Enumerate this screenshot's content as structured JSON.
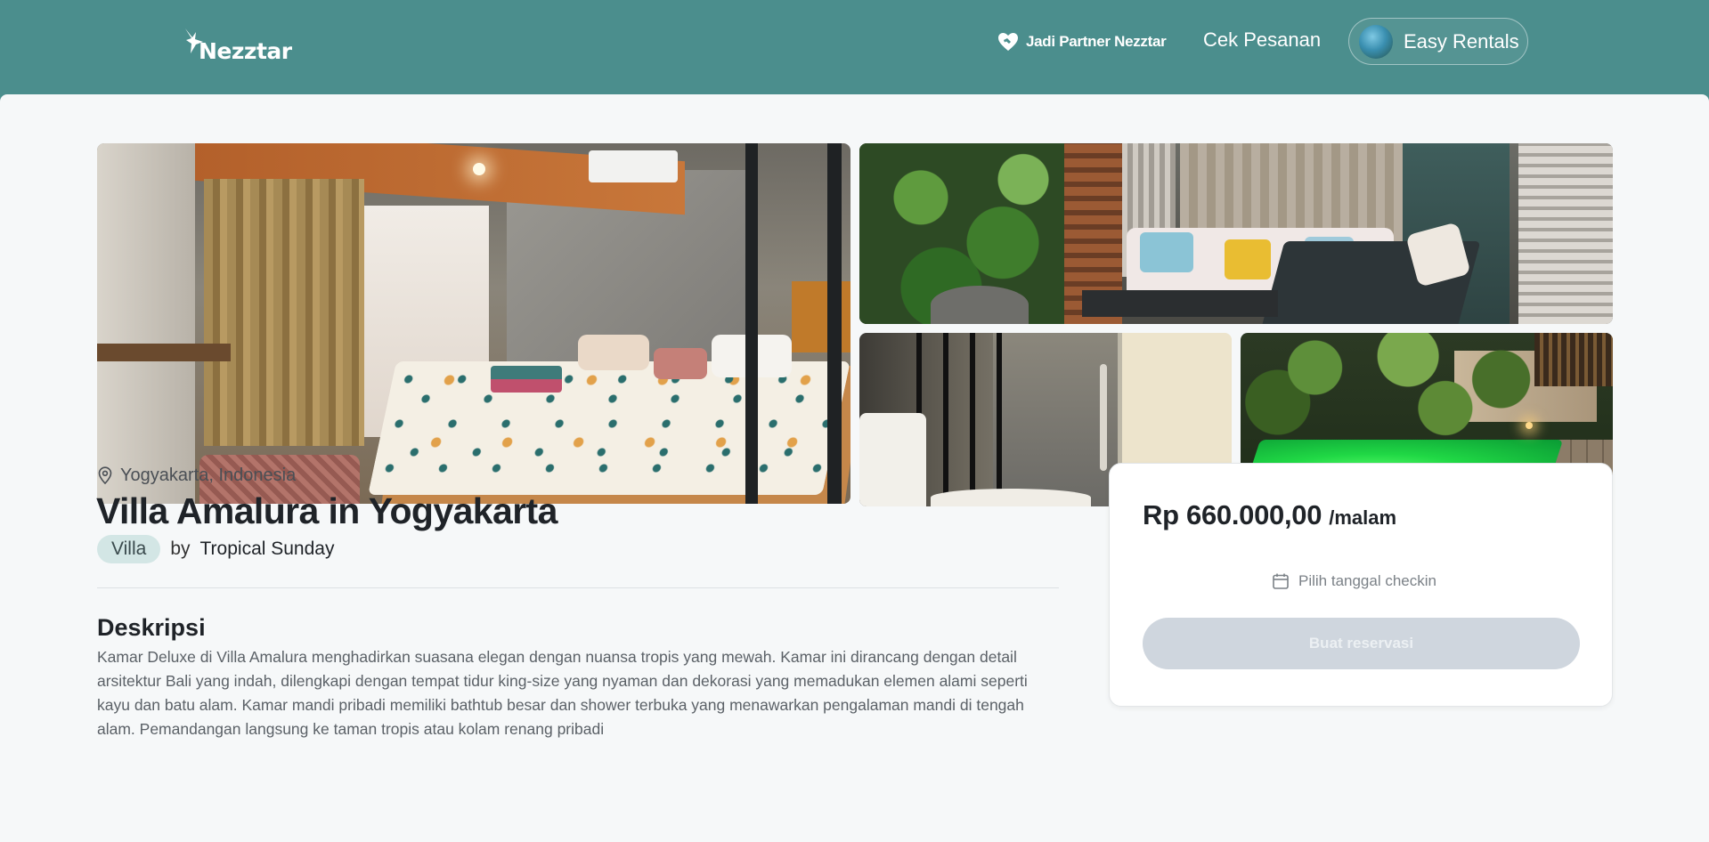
{
  "header": {
    "logo_text": "Nezztar",
    "partner_link": "Jadi Partner Nezztar",
    "orders_link": "Cek Pesanan",
    "account_label": "Easy Rentals"
  },
  "listing": {
    "location": "Yogyakarta, Indonesia",
    "title": "Villa Amalura in Yogyakarta",
    "type": "Villa",
    "by_label": "by",
    "host": "Tropical Sunday",
    "description_heading": "Deskripsi",
    "description": "Kamar Deluxe di Villa Amalura menghadirkan suasana elegan dengan nuansa tropis yang mewah. Kamar ini dirancang dengan detail arsitektur Bali yang indah, dilengkapi dengan tempat tidur king-size yang nyaman dan dekorasi yang memadukan elemen alami seperti kayu dan batu alam. Kamar mandi pribadi memiliki bathtub besar dan shower terbuka yang menawarkan pengalaman mandi di tengah alam. Pemandangan langsung ke taman tropis atau kolam renang pribadi"
  },
  "booking": {
    "price": "Rp 660.000,00",
    "per_night": "/malam",
    "date_placeholder": "Pilih tanggal checkin",
    "reserve_button": "Buat reservasi"
  },
  "colors": {
    "header_bg": "#4b8e8d",
    "page_bg": "#f6f8f9",
    "badge_bg": "#d3e6e5",
    "disabled_button": "#cfd6de"
  },
  "icons": {
    "partner": "heart-handshake-icon",
    "location": "map-pin-icon",
    "date": "calendar-icon"
  }
}
